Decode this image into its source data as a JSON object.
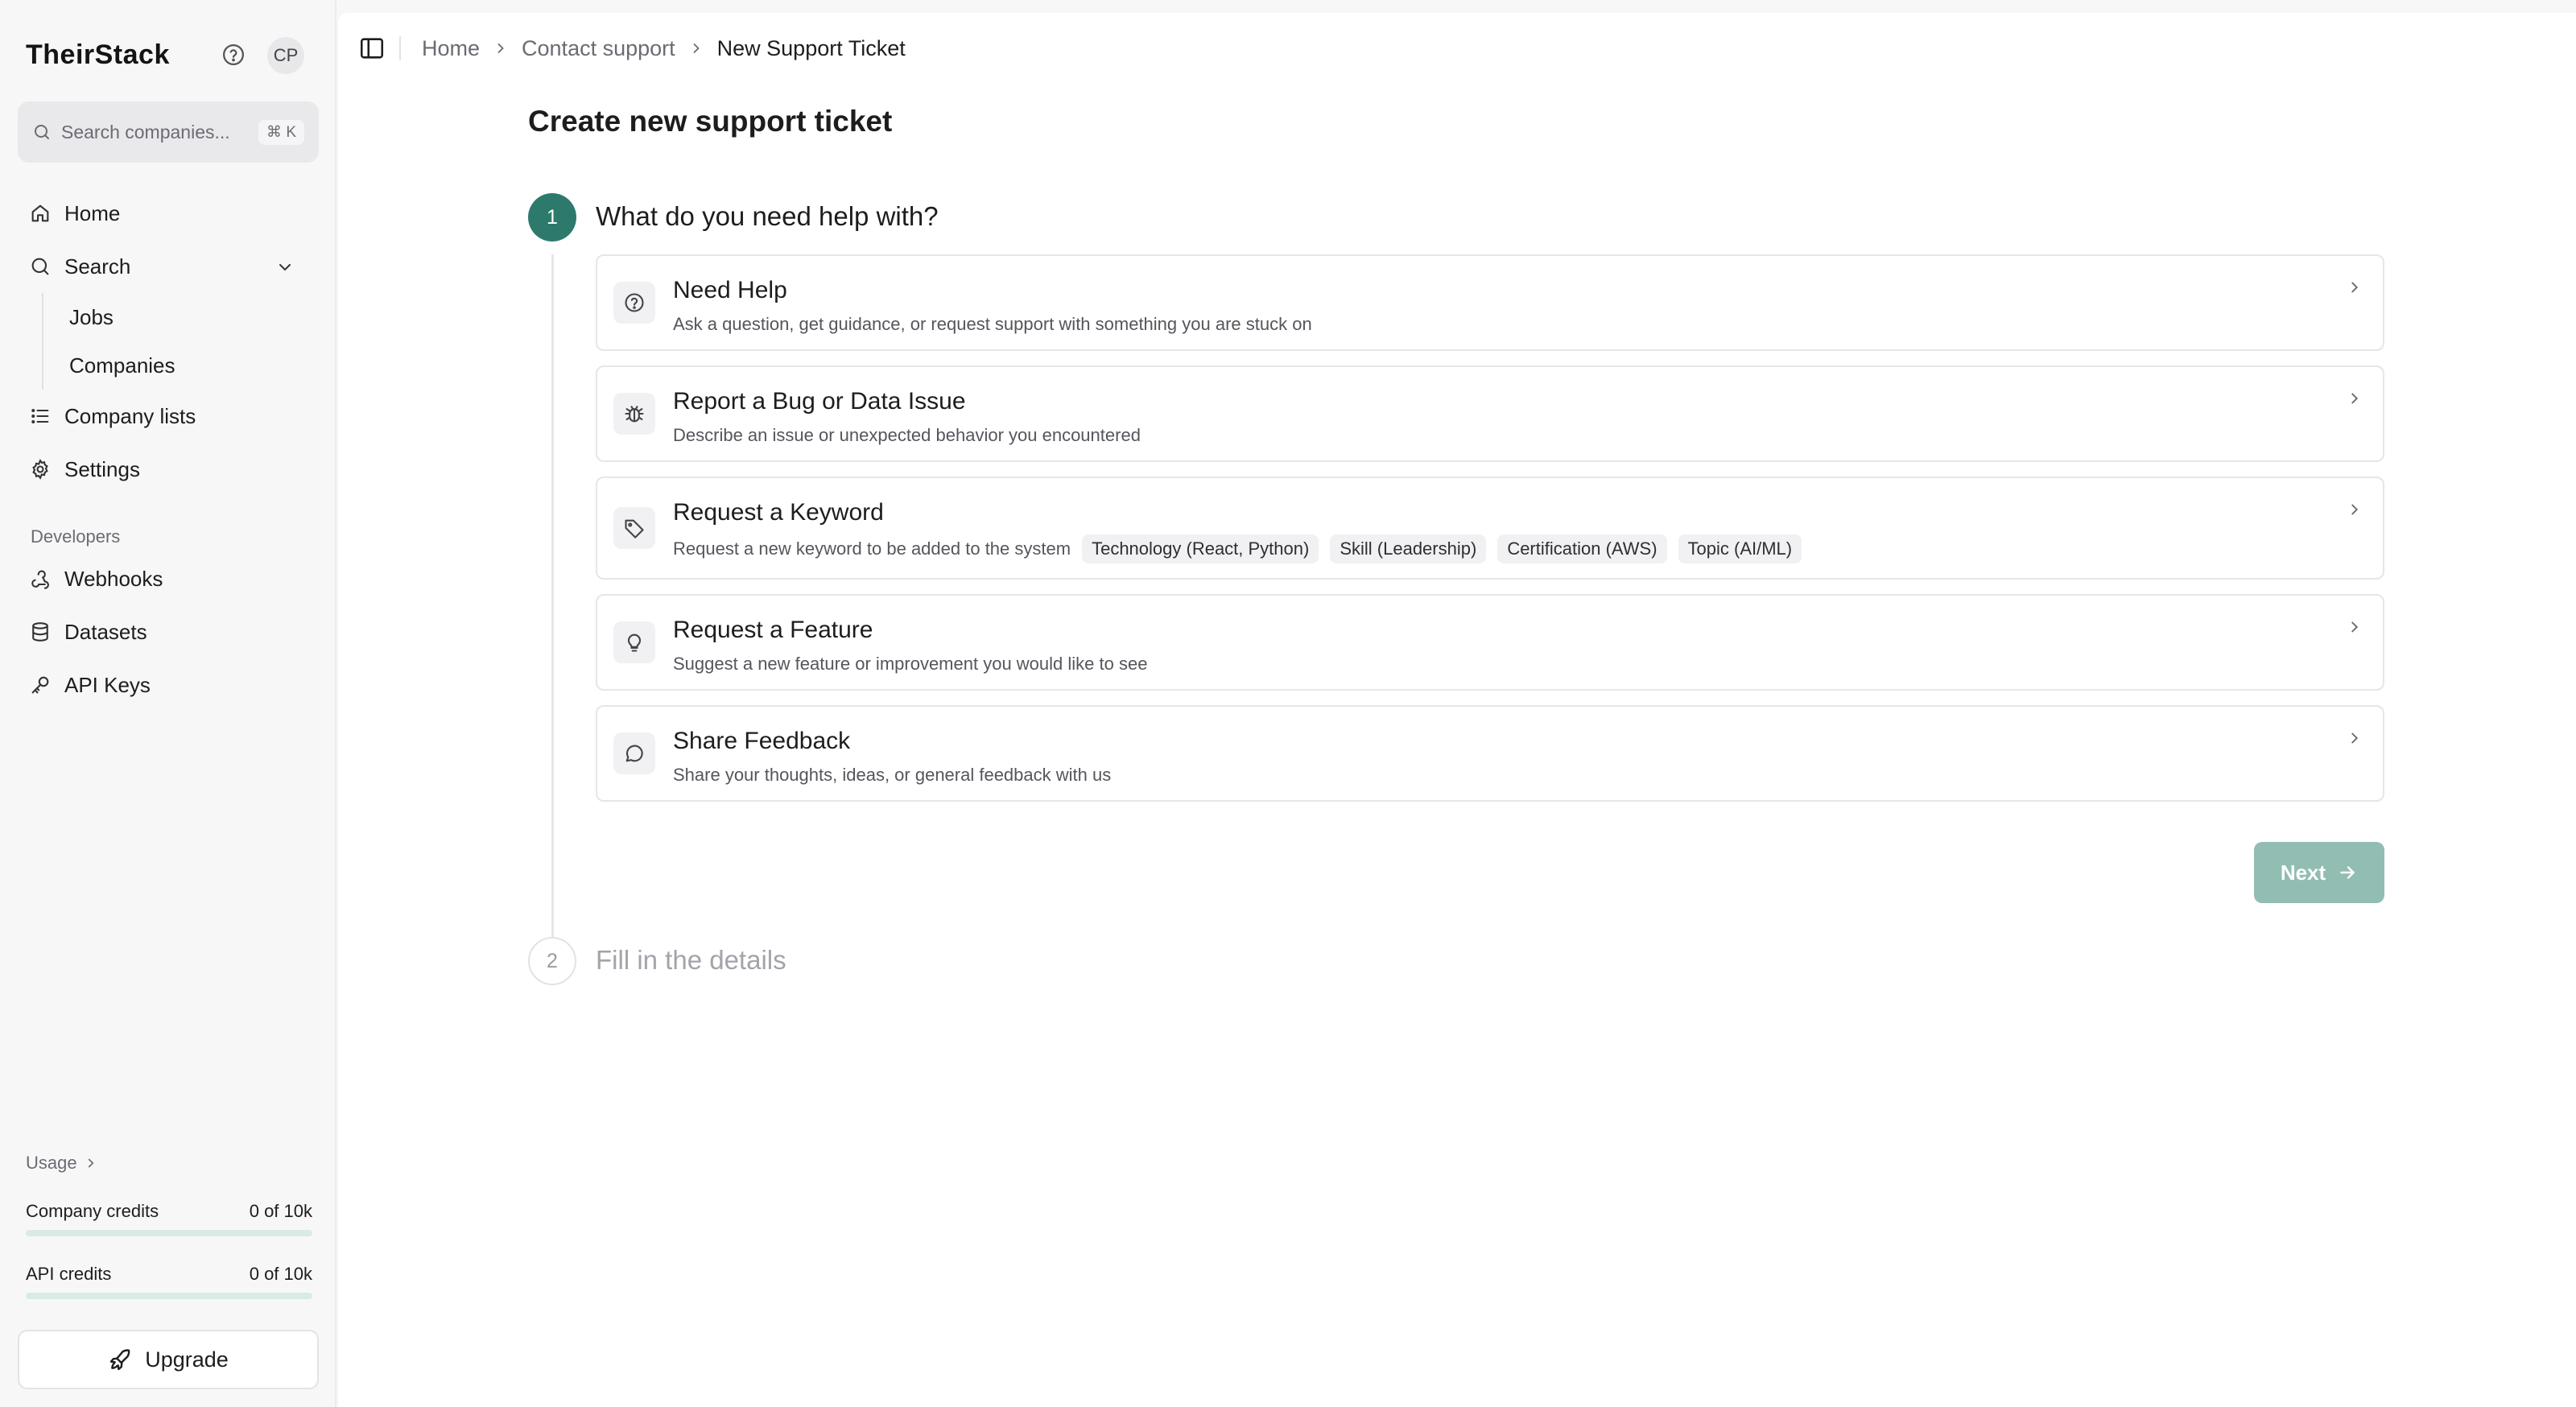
{
  "app": {
    "brand": "TheirStack",
    "avatar_initials": "CP"
  },
  "search": {
    "placeholder": "Search companies...",
    "shortcut": "⌘ K"
  },
  "sidebar": {
    "items": [
      {
        "label": "Home"
      },
      {
        "label": "Search"
      },
      {
        "label": "Jobs"
      },
      {
        "label": "Companies"
      },
      {
        "label": "Company lists"
      },
      {
        "label": "Settings"
      }
    ],
    "developers_label": "Developers",
    "dev_items": [
      {
        "label": "Webhooks"
      },
      {
        "label": "Datasets"
      },
      {
        "label": "API Keys"
      }
    ],
    "usage": {
      "title": "Usage",
      "company_credits": {
        "label": "Company credits",
        "value": "0 of 10k",
        "fraction": 0.0
      },
      "api_credits": {
        "label": "API credits",
        "value": "0 of 10k",
        "fraction": 0.0
      }
    },
    "upgrade_label": "Upgrade"
  },
  "breadcrumb": [
    "Home",
    "Contact support",
    "New Support Ticket"
  ],
  "page": {
    "title": "Create new support ticket",
    "step1": {
      "number": "1",
      "title": "What do you need help with?"
    },
    "step2": {
      "number": "2",
      "title": "Fill in the details"
    },
    "options": [
      {
        "title": "Need Help",
        "description": "Ask a question, get guidance, or request support with something you are stuck on"
      },
      {
        "title": "Report a Bug or Data Issue",
        "description": "Describe an issue or unexpected behavior you encountered"
      },
      {
        "title": "Request a Keyword",
        "description": "Request a new keyword to be added to the system",
        "tags": [
          "Technology (React, Python)",
          "Skill (Leadership)",
          "Certification (AWS)",
          "Topic (AI/ML)"
        ]
      },
      {
        "title": "Request a Feature",
        "description": "Suggest a new feature or improvement you would like to see"
      },
      {
        "title": "Share Feedback",
        "description": "Share your thoughts, ideas, or general feedback with us"
      }
    ],
    "next_label": "Next"
  },
  "colors": {
    "accent": "#2d7a6c",
    "next_disabled": "#92bdb3"
  }
}
